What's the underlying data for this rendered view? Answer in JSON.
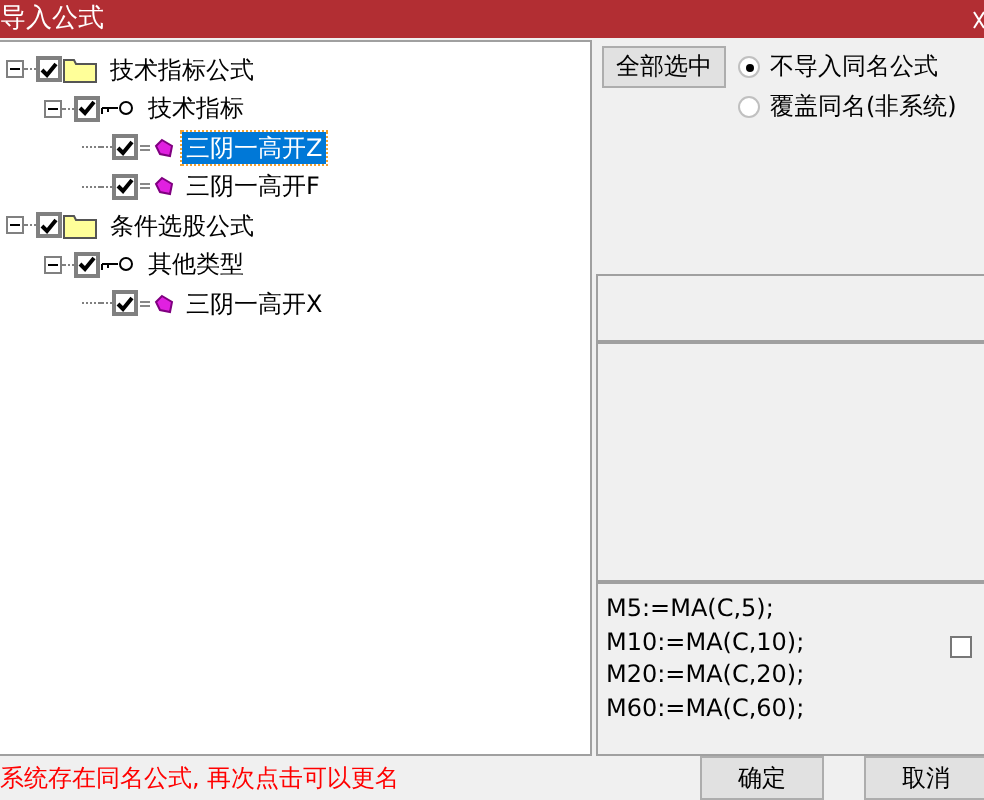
{
  "window": {
    "title": "导入公式"
  },
  "tree": [
    {
      "label": "技术指标公式",
      "kind": "folder",
      "checked": true,
      "expanded": true,
      "selected": false,
      "children": [
        {
          "label": "技术指标",
          "kind": "group",
          "checked": true,
          "expanded": true,
          "selected": false,
          "children": [
            {
              "label": "三阴一高开Z",
              "kind": "formula",
              "checked": true,
              "selected": true
            },
            {
              "label": "三阴一高开F",
              "kind": "formula",
              "checked": true,
              "selected": false
            }
          ]
        }
      ]
    },
    {
      "label": "条件选股公式",
      "kind": "folder",
      "checked": true,
      "expanded": true,
      "selected": false,
      "children": [
        {
          "label": "其他类型",
          "kind": "group",
          "checked": true,
          "expanded": true,
          "selected": false,
          "children": [
            {
              "label": "三阴一高开X",
              "kind": "formula",
              "checked": true,
              "selected": false
            }
          ]
        }
      ]
    }
  ],
  "select_all_button": "全部选中",
  "options": [
    {
      "label": "不导入同名公式",
      "selected": true
    },
    {
      "label": "覆盖同名(非系统)",
      "selected": false
    }
  ],
  "formula_lines": [
    "M5:=MA(C,5);",
    "M10:=MA(C,10);",
    "M20:=MA(C,20);",
    "M60:=MA(C,60);"
  ],
  "formula_checkbox": {
    "checked": false
  },
  "status_message": "系统存在同名公式, 再次点击可以更名",
  "buttons": [
    "确定",
    "取消"
  ]
}
